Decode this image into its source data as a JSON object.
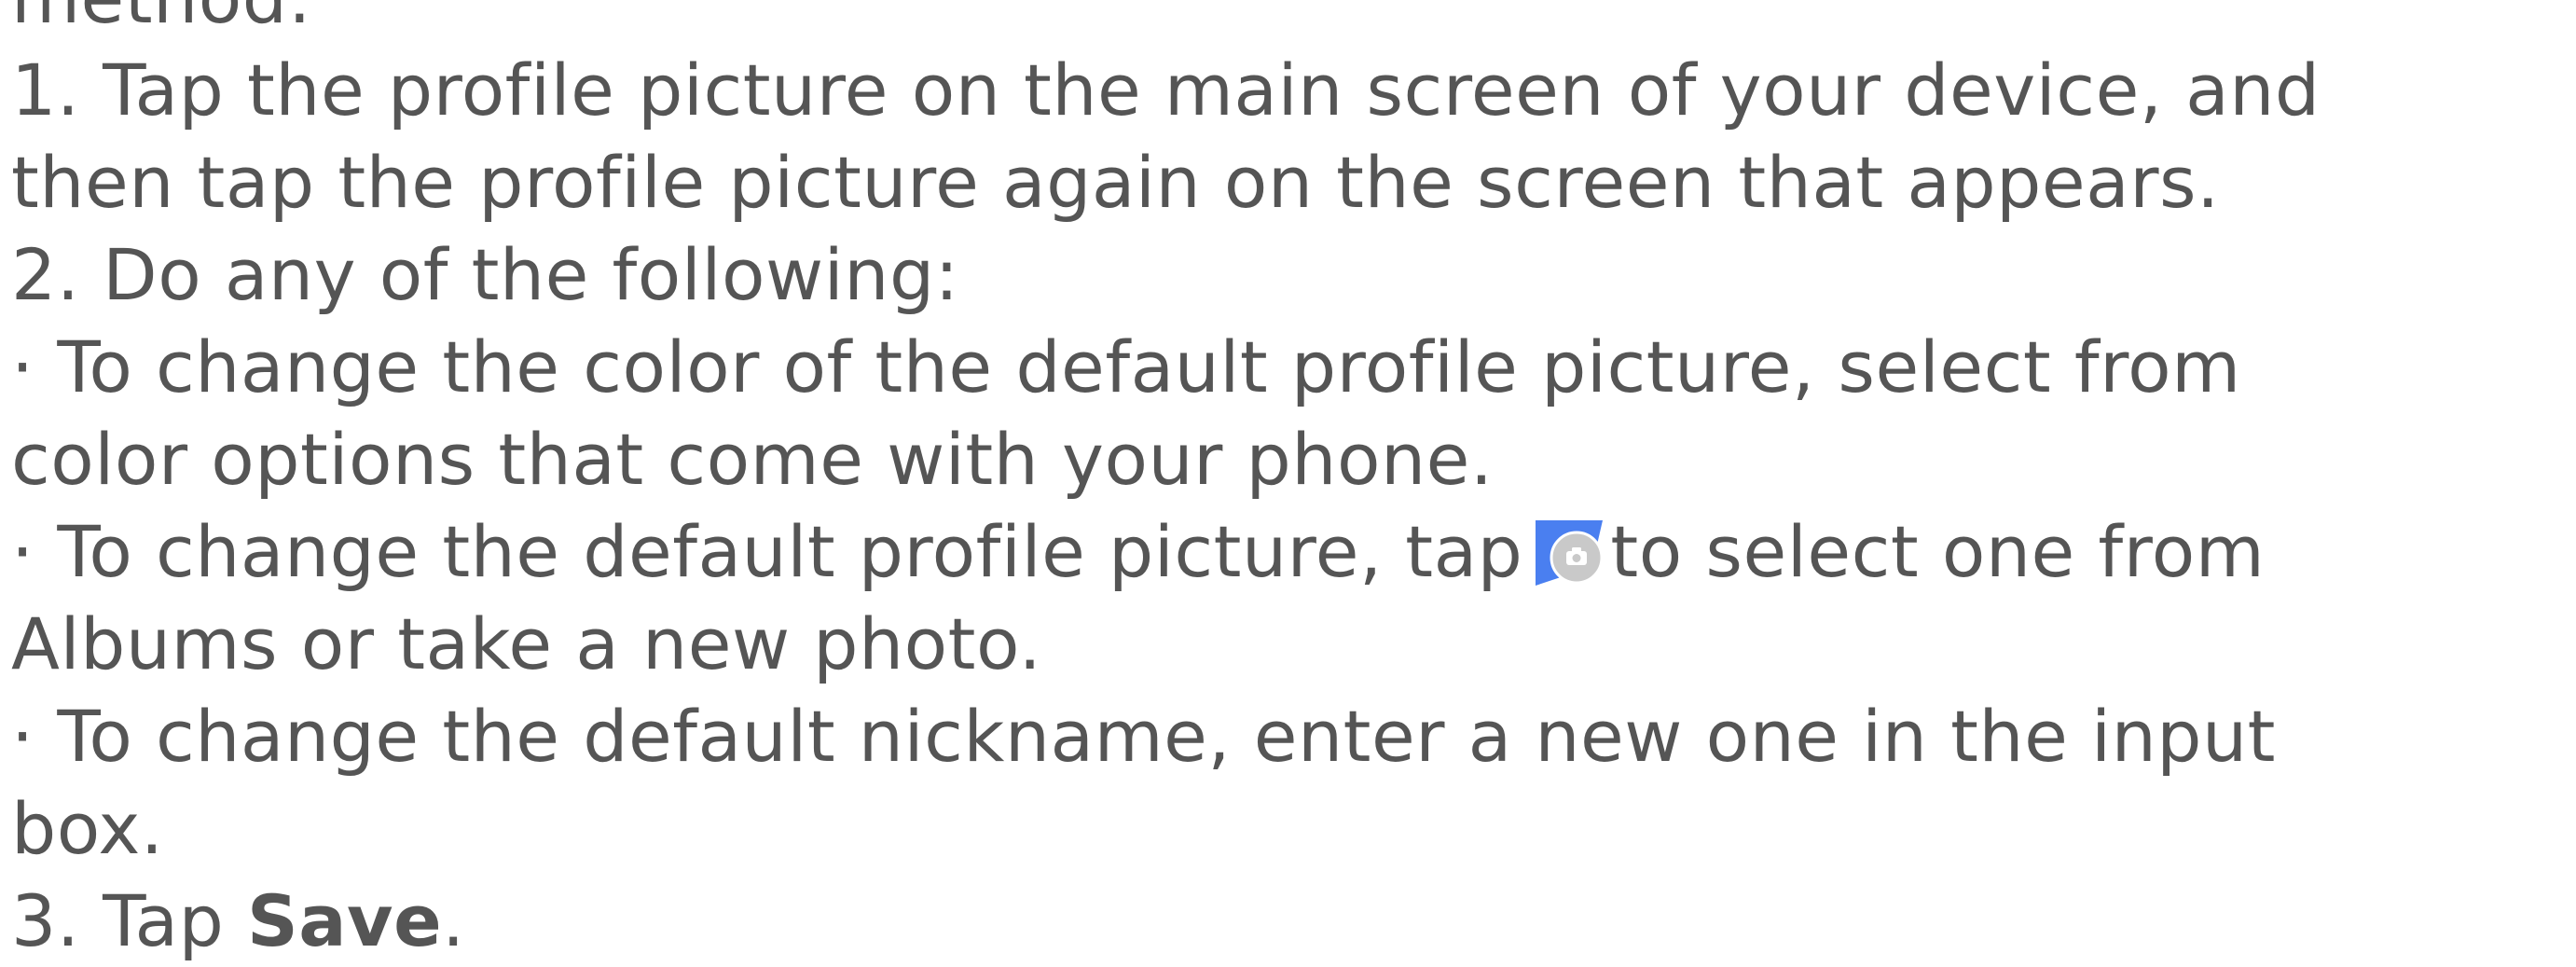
{
  "document": {
    "partial_heading": "method:",
    "step1_line1": "1. Tap the profile picture on the main screen of your device, and",
    "step1_line2": "then tap the profile picture again on the screen that appears.",
    "step2": "2. Do any of the following:",
    "bullet1_line1": "· To change the color of the default profile picture, select from",
    "bullet1_line2": "color options that come with your phone.",
    "bullet2_line1_before": "· To change the default profile picture, tap",
    "bullet2_icon": "camera-icon",
    "bullet2_line1_after": "to select one from",
    "bullet2_line2": "Albums or take a new photo.",
    "bullet3_line1": "· To change the default nickname, enter a new one in the input",
    "bullet3_line2": "box.",
    "step3_prefix": "3. Tap",
    "step3_bold": "Save",
    "step3_suffix": "."
  },
  "colors": {
    "text": "#555555",
    "icon_accent": "#4a7ff0",
    "icon_circle": "#c9c9c9"
  }
}
